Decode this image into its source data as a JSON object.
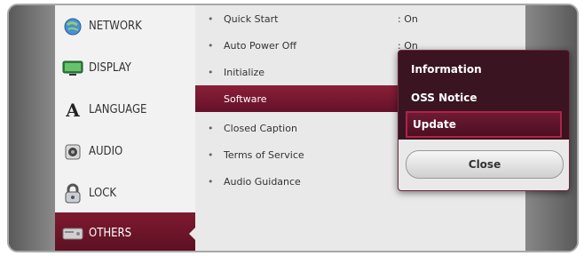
{
  "sidebar": {
    "items": [
      {
        "label": "NETWORK",
        "icon": "network-globe-icon"
      },
      {
        "label": "DISPLAY",
        "icon": "monitor-icon"
      },
      {
        "label": "LANGUAGE",
        "icon": "letter-a-icon"
      },
      {
        "label": "AUDIO",
        "icon": "speaker-icon"
      },
      {
        "label": "LOCK",
        "icon": "padlock-icon"
      },
      {
        "label": "OTHERS",
        "icon": "others-box-icon"
      }
    ],
    "active_index": 5
  },
  "main": {
    "rows": [
      {
        "label": "Quick Start",
        "value": ": On"
      },
      {
        "label": "Auto Power Off",
        "value": ": On"
      },
      {
        "label": "Initialize",
        "value": ""
      },
      {
        "label": "Software",
        "value": ""
      },
      {
        "label": "Closed Caption",
        "value": ""
      },
      {
        "label": "Terms of Service",
        "value": ""
      },
      {
        "label": "Audio Guidance",
        "value": ""
      }
    ],
    "selected_index": 3
  },
  "popup": {
    "items": [
      "Information",
      "OSS Notice",
      "Update"
    ],
    "focused_index": 2,
    "close_label": "Close"
  },
  "colors": {
    "accent": "#7e1a30",
    "popup_bg": "#3a1420"
  }
}
